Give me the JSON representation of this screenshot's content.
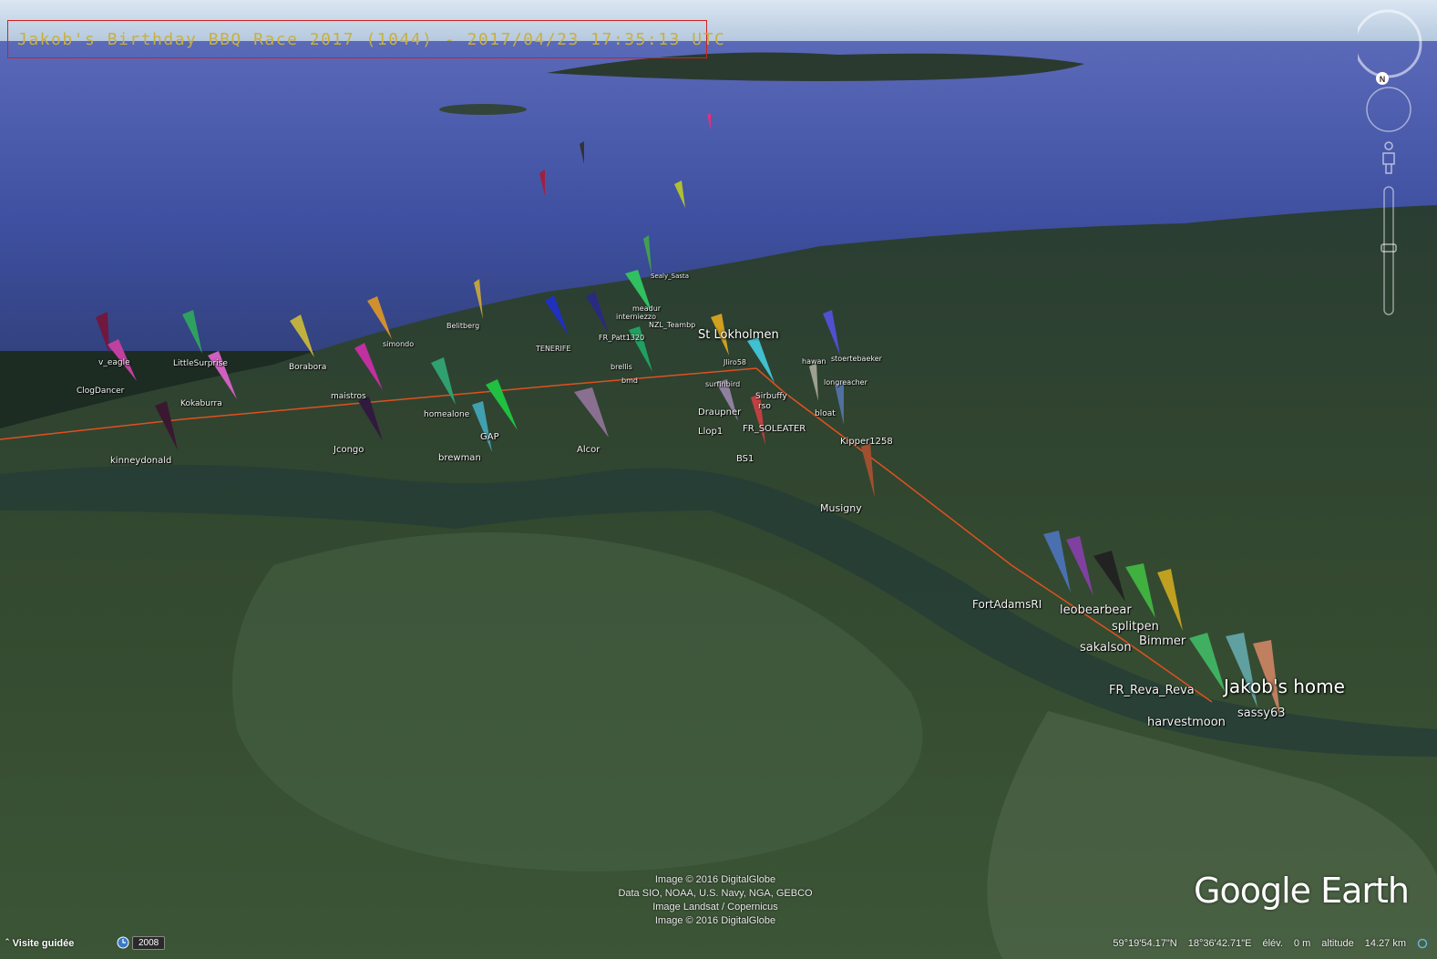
{
  "app": {
    "name": "Google Earth",
    "title_overlay": "Jakob's Birthday BBQ Race 2017 (1044) - 2017/04/23 17:35:13 UTC"
  },
  "places": [
    {
      "id": "st-lokholmen",
      "label": "St Lokholmen"
    },
    {
      "id": "jakobs-home",
      "label": "Jakob's home"
    }
  ],
  "boats": [
    {
      "label": "Sealy_Sasta"
    },
    {
      "label": "meadur"
    },
    {
      "label": "interniezzo"
    },
    {
      "label": "NZL_Teambp"
    },
    {
      "label": "Belitberg"
    },
    {
      "label": "simondo"
    },
    {
      "label": "TENERIFE"
    },
    {
      "label": "FR_Patt1320"
    },
    {
      "label": "v_eagle"
    },
    {
      "label": "LittleSurprise"
    },
    {
      "label": "Borabora"
    },
    {
      "label": "ClogDancer"
    },
    {
      "label": "Kokaburra"
    },
    {
      "label": "maistros"
    },
    {
      "label": "homealone"
    },
    {
      "label": "brellis"
    },
    {
      "label": "bmd"
    },
    {
      "label": "Jliro58"
    },
    {
      "label": "hawan"
    },
    {
      "label": "stoertebaeker"
    },
    {
      "label": "surfinbird"
    },
    {
      "label": "Sirbuffy"
    },
    {
      "label": "rso"
    },
    {
      "label": "longreacher"
    },
    {
      "label": "Draupner"
    },
    {
      "label": "bloat"
    },
    {
      "label": "FR_SOLEATER"
    },
    {
      "label": "Llop1"
    },
    {
      "label": "kinneydonald"
    },
    {
      "label": "Jcongo"
    },
    {
      "label": "GAP"
    },
    {
      "label": "brewman"
    },
    {
      "label": "Alcor"
    },
    {
      "label": "BS1"
    },
    {
      "label": "Kipper1258"
    },
    {
      "label": "Musigny"
    },
    {
      "label": "FortAdamsRI"
    },
    {
      "label": "leobearbear"
    },
    {
      "label": "splitpen"
    },
    {
      "label": "sakalson"
    },
    {
      "label": "Bimmer"
    },
    {
      "label": "FR_Reva_Reva"
    },
    {
      "label": "sassy63"
    },
    {
      "label": "harvestmoon"
    }
  ],
  "attribution": [
    "Image © 2016 DigitalGlobe",
    "Data SIO, NOAA, U.S. Navy, NGA, GEBCO",
    "Image Landsat / Copernicus",
    "Image © 2016 DigitalGlobe"
  ],
  "logo_text": "Google Earth",
  "statusbar": {
    "tour_label": "Visite guidée",
    "year": "2008",
    "lat": "59°19'54.17\"N",
    "lon": "18°36'42.71\"E",
    "elev_label": "élév.",
    "elev_value": "0 m",
    "alt_label": "altitude",
    "alt_value": "14.27 km"
  },
  "nav": {
    "compass_label": "N"
  },
  "colors": {
    "route": "#e05020",
    "title_text": "#c8b040",
    "title_border": "#d02020"
  }
}
